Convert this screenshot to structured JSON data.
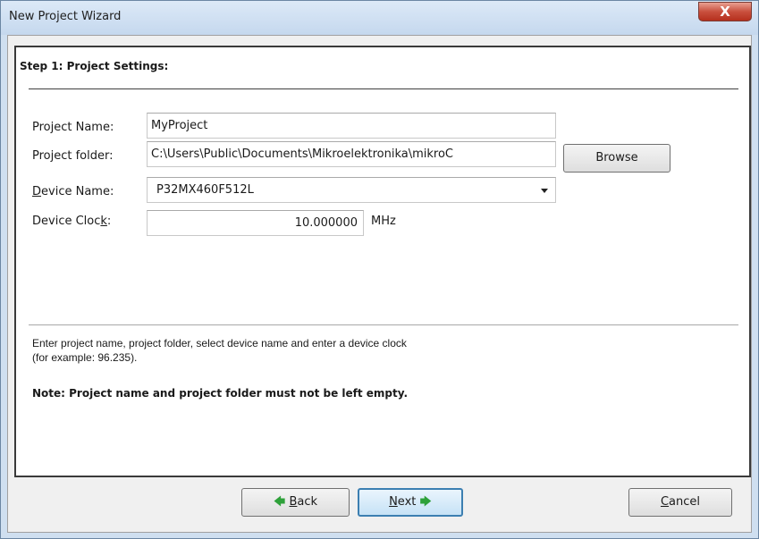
{
  "window": {
    "title": "New Project Wizard",
    "close_label": "X"
  },
  "step": {
    "title": "Step 1: Project Settings:"
  },
  "fields": {
    "project_name": {
      "label": "Project Name:",
      "value": "MyProject"
    },
    "project_folder": {
      "label": "Project folder:",
      "value": "C:\\Users\\Public\\Documents\\Mikroelektronika\\mikroC"
    },
    "device_name": {
      "label_underlined": "D",
      "label_rest": "evice Name:",
      "value": "P32MX460F512L"
    },
    "device_clock": {
      "label_pre": "Device Cloc",
      "label_underlined": "k",
      "label_post": ":",
      "value": "10.000000",
      "unit": "MHz"
    }
  },
  "buttons": {
    "browse": "Browse",
    "back": {
      "arrow": "🡄",
      "underlined": "B",
      "rest": "ack"
    },
    "next": {
      "underlined": "N",
      "rest": "ext",
      "arrow": "🡆"
    },
    "cancel": {
      "underlined": "C",
      "rest": "ancel"
    }
  },
  "description": {
    "line1": "Enter project name, project folder, select device name and enter a device clock",
    "line2": "(for example: 96.235)."
  },
  "note": "Note: Project name and project folder must not be left empty."
}
